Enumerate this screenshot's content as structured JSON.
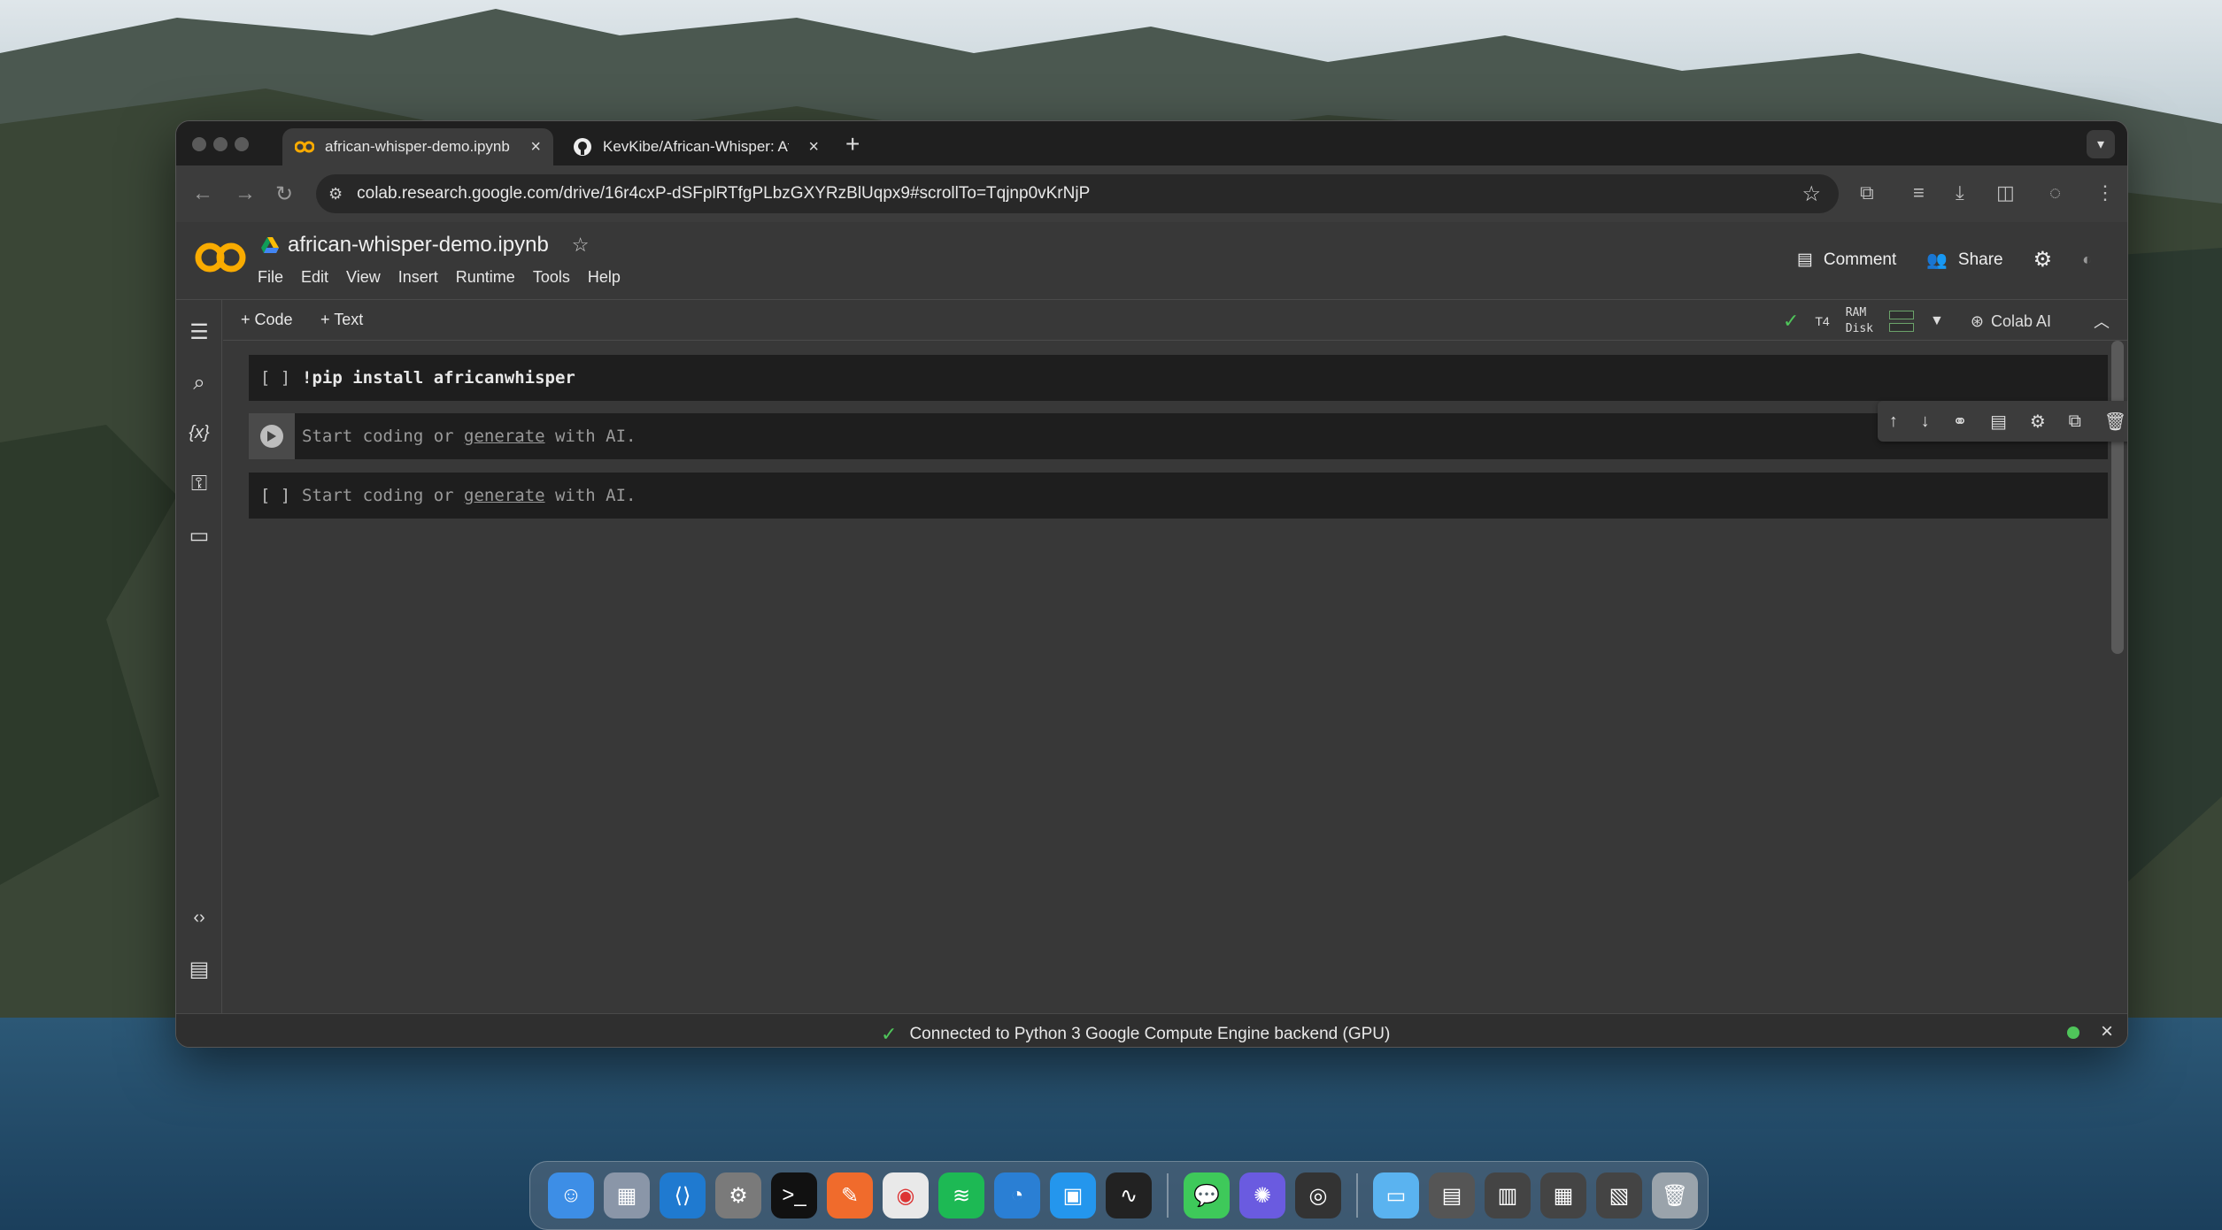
{
  "browser": {
    "tabs": [
      {
        "label": "african-whisper-demo.ipynb",
        "active": true,
        "icon": "colab-icon"
      },
      {
        "label": "KevKibe/African-Whisper: Af",
        "active": false,
        "icon": "github-icon"
      }
    ],
    "new_tab": "+",
    "url": "colab.research.google.com/drive/16r4cxP-dSFplRTfgPLbzGXYRzBlUqpx9#scrollTo=Tqjnp0vKrNjP"
  },
  "colab": {
    "title": "african-whisper-demo.ipynb",
    "menu": [
      "File",
      "Edit",
      "View",
      "Insert",
      "Runtime",
      "Tools",
      "Help"
    ],
    "comment_label": "Comment",
    "share_label": "Share",
    "add_code": "+ Code",
    "add_text": "+ Text",
    "runtime": {
      "gpu": "T4",
      "ram": "RAM",
      "disk": "Disk",
      "status_color": "#4fc55a"
    },
    "colab_ai": "Colab AI",
    "cells": [
      {
        "bracket": "[ ]",
        "code": "!pip install africanwhisper"
      },
      {
        "prefix": "Start coding or ",
        "link": "generate",
        "suffix": " with AI."
      },
      {
        "bracket": "[ ]",
        "prefix": "Start coding or ",
        "link": "generate",
        "suffix": " with AI."
      }
    ],
    "status": "Connected to Python 3 Google Compute Engine backend (GPU)"
  },
  "colors": {
    "accent_orange": "#f9ab00",
    "status_green": "#4fc55a"
  }
}
